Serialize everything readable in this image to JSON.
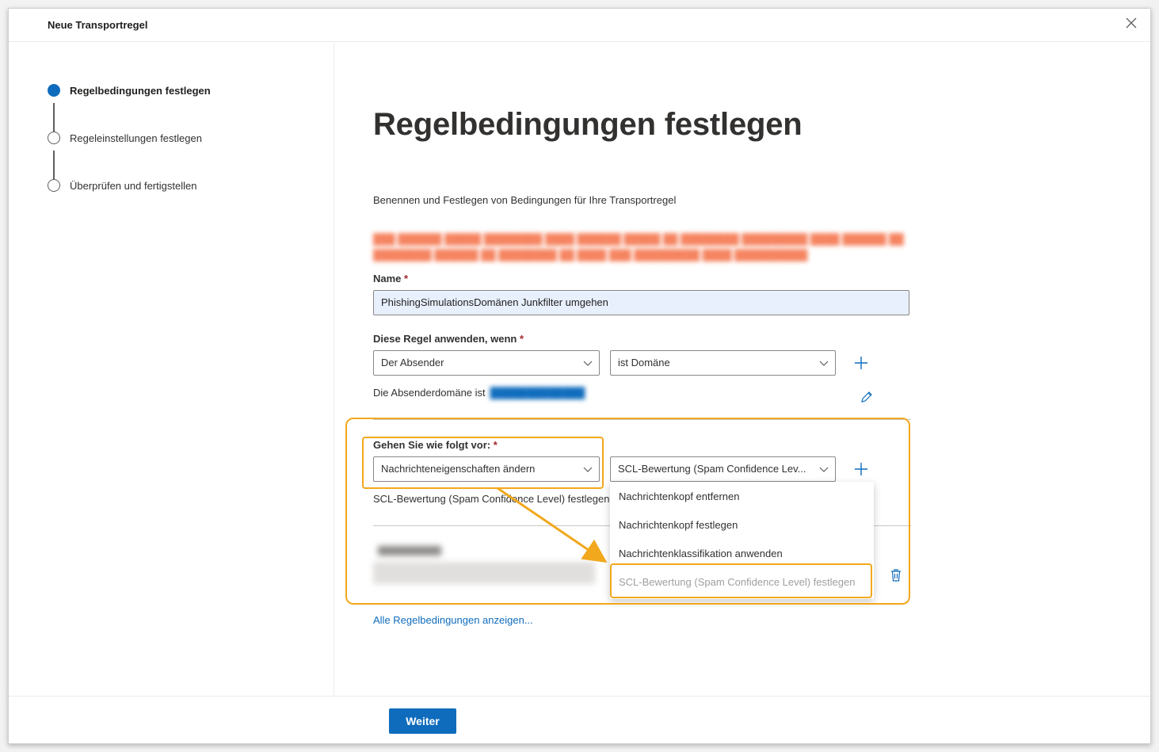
{
  "dialog": {
    "title": "Neue Transportregel"
  },
  "steps": [
    {
      "label": "Regelbedingungen festlegen",
      "state": "active"
    },
    {
      "label": "Regeleinstellungen festlegen",
      "state": "pending"
    },
    {
      "label": "Überprüfen und fertigstellen",
      "state": "pending"
    }
  ],
  "main": {
    "title": "Regelbedingungen festlegen",
    "description": "Benennen und Festlegen von Bedingungen für Ihre Transportregel",
    "name_label": "Name",
    "name_value": "PhishingSimulationsDomänen Junkfilter umgehen",
    "apply_label": "Diese Regel anwenden, wenn",
    "apply_select1": "Der Absender",
    "apply_select2": "ist Domäne",
    "apply_info": "Die Absenderdomäne ist",
    "action_label": "Gehen Sie wie folgt vor:",
    "action_select1": "Nachrichteneigenschaften ändern",
    "action_select2": "SCL-Bewertung (Spam Confidence Lev...",
    "action_info": "SCL-Bewertung (Spam Confidence Level) festlegen",
    "show_all_link": "Alle Regelbedingungen anzeigen..."
  },
  "dropdown": {
    "items": [
      "Nachrichtenkopf entfernen",
      "Nachrichtenkopf festlegen",
      "Nachrichtenklassifikation anwenden",
      "SCL-Bewertung (Spam Confidence Level) festlegen"
    ]
  },
  "footer": {
    "next_label": "Weiter"
  },
  "colors": {
    "accent": "#0f6cbd",
    "highlight": "#f2a81d"
  }
}
